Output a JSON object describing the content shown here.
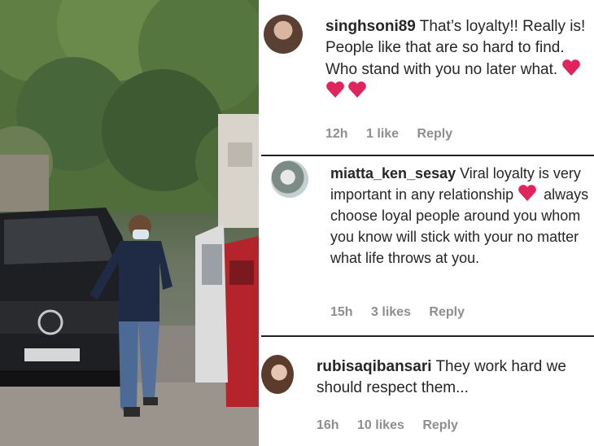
{
  "comments": [
    {
      "username": "singhsoni89",
      "text": "That’s loyalty!! Really is! People like that are so hard to find. Who stand with you no later what.",
      "emoji": "heart-emoji x3",
      "time": "12h",
      "likes": "1 like",
      "reply_label": "Reply"
    },
    {
      "username": "miatta_ken_sesay",
      "text_before_emoji": "Viral loyalty is very important in any relationship",
      "emoji": "heart-emoji",
      "text_after_emoji": "always choose loyal people around you whom you know will stick with your no matter what life throws at you.",
      "time": "15h",
      "likes": "3 likes",
      "reply_label": "Reply"
    },
    {
      "username": "rubisaqibansari",
      "text": "They work hard we should respect them...",
      "time": "16h",
      "likes": "10 likes",
      "reply_label": "Reply"
    }
  ],
  "colors": {
    "text": "#262626",
    "meta": "#8e8e8e",
    "heart": "#e0245e"
  }
}
